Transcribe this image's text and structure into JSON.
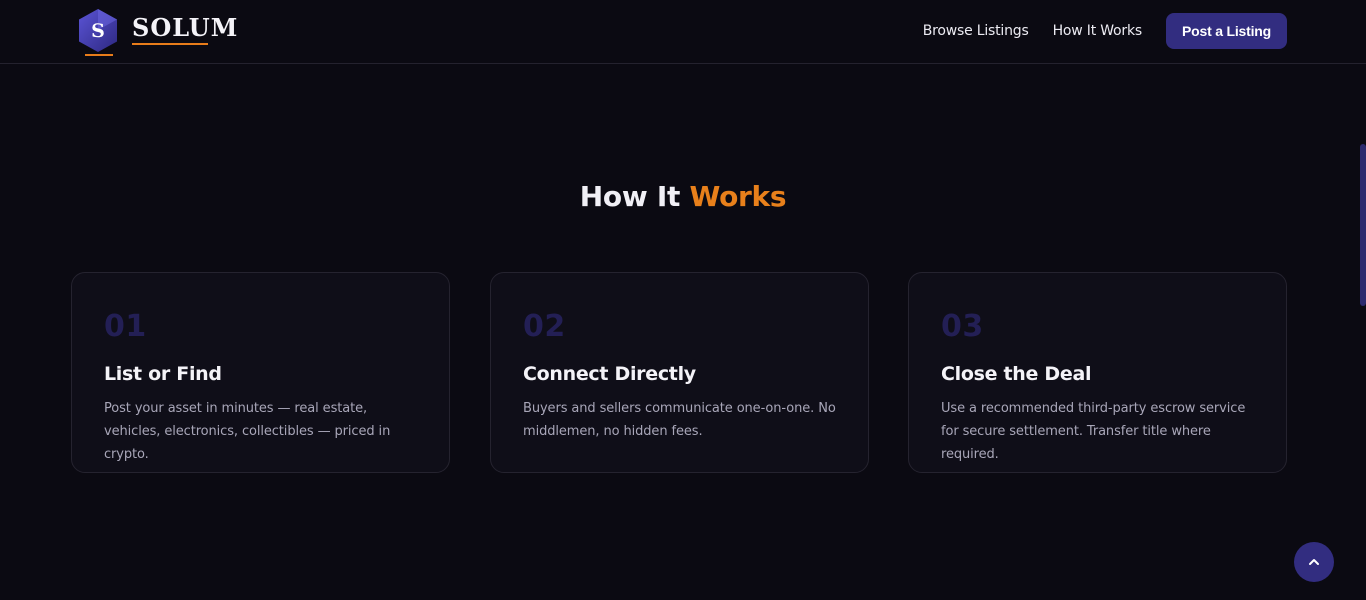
{
  "header": {
    "brand_letter": "S",
    "brand_name": "SOLUM",
    "nav": [
      {
        "label": "Browse Listings"
      },
      {
        "label": "How It Works"
      }
    ],
    "cta_label": "Post a Listing"
  },
  "section": {
    "title_main": "How It",
    "title_accent": "Works"
  },
  "steps": [
    {
      "number": "01",
      "title": "List or Find",
      "description": "Post your asset in minutes — real estate, vehicles, electronics, collectibles — priced in crypto."
    },
    {
      "number": "02",
      "title": "Connect Directly",
      "description": "Buyers and sellers communicate one-on-one. No middlemen, no hidden fees."
    },
    {
      "number": "03",
      "title": "Close the Deal",
      "description": "Use a recommended third-party escrow service for secure settlement. Transfer title where required."
    }
  ],
  "icons": {
    "logo": "hexagon-logo-icon",
    "back_to_top": "chevron-up-icon"
  },
  "colors": {
    "background": "#0b0a12",
    "accent": "#e8801b",
    "brand": "#322d80"
  }
}
